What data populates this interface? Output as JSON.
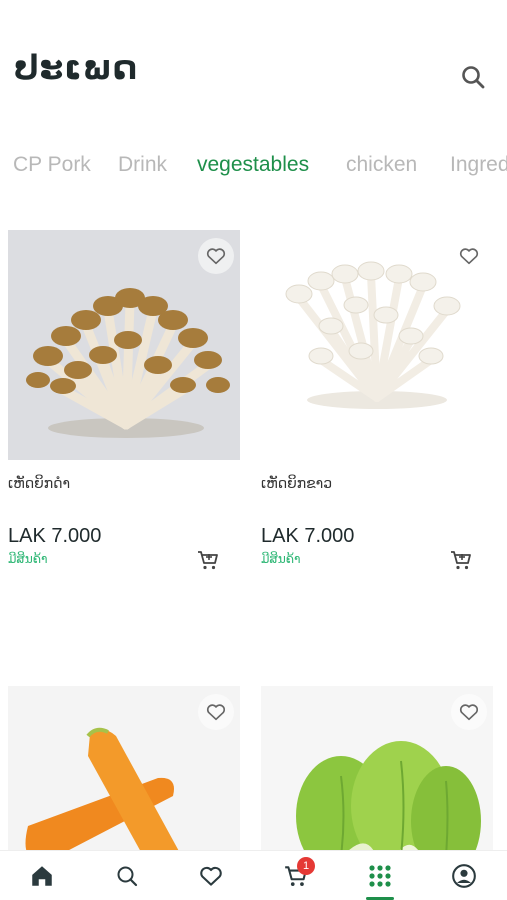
{
  "header": {
    "title": "ປະເພດ"
  },
  "tabs": [
    {
      "label": "CP Pork",
      "active": false
    },
    {
      "label": "Drink",
      "active": false
    },
    {
      "label": "vegestables",
      "active": true
    },
    {
      "label": "chicken",
      "active": false
    },
    {
      "label": "Ingred",
      "active": false
    }
  ],
  "products": [
    {
      "name": "ເຫັດຍິກດຳ",
      "price": "LAK 7.000",
      "stock": "ມີສິນຄ້າ"
    },
    {
      "name": "ເຫັດຍິກຂາວ",
      "price": "LAK 7.000",
      "stock": "ມີສິນຄ້າ"
    },
    {
      "name": "",
      "price": "",
      "stock": ""
    },
    {
      "name": "",
      "price": "",
      "stock": ""
    }
  ],
  "bottom_nav": {
    "items": [
      "home-icon",
      "search-icon",
      "heart-icon",
      "cart-icon",
      "grid-icon",
      "profile-icon"
    ],
    "cart_badge": "1",
    "active": "grid-icon",
    "accent": "#1e8f4a"
  }
}
